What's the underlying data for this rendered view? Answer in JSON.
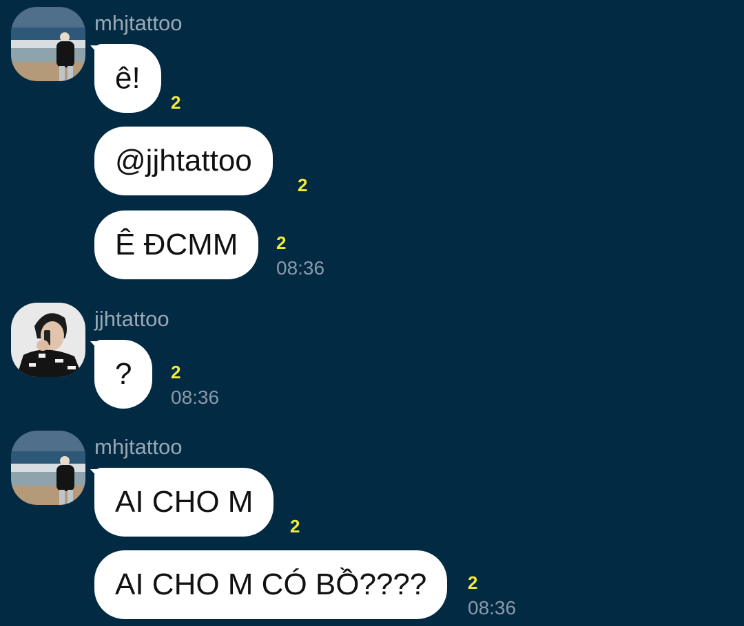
{
  "messages": [
    {
      "sender": "mhjtattoo",
      "avatar": "beach-avatar",
      "bubbles": [
        {
          "text": "ê!",
          "unread": "2",
          "time": ""
        },
        {
          "text": "@jjhtattoo",
          "unread": "2",
          "time": ""
        },
        {
          "text": "Ê ĐCMM",
          "unread": "2",
          "time": "08:36"
        }
      ]
    },
    {
      "sender": "jjhtattoo",
      "avatar": "phone-call-avatar",
      "bubbles": [
        {
          "text": "?",
          "unread": "2",
          "time": "08:36"
        }
      ]
    },
    {
      "sender": "mhjtattoo",
      "avatar": "beach-avatar",
      "bubbles": [
        {
          "text": "AI CHO M",
          "unread": "2",
          "time": ""
        },
        {
          "text": "AI CHO M CÓ BỒ????",
          "unread": "2",
          "time": "08:36"
        }
      ]
    }
  ],
  "colors": {
    "background": "#032a43",
    "bubble": "#ffffff",
    "unread": "#f3ea3a",
    "meta": "#8a9aaa"
  }
}
